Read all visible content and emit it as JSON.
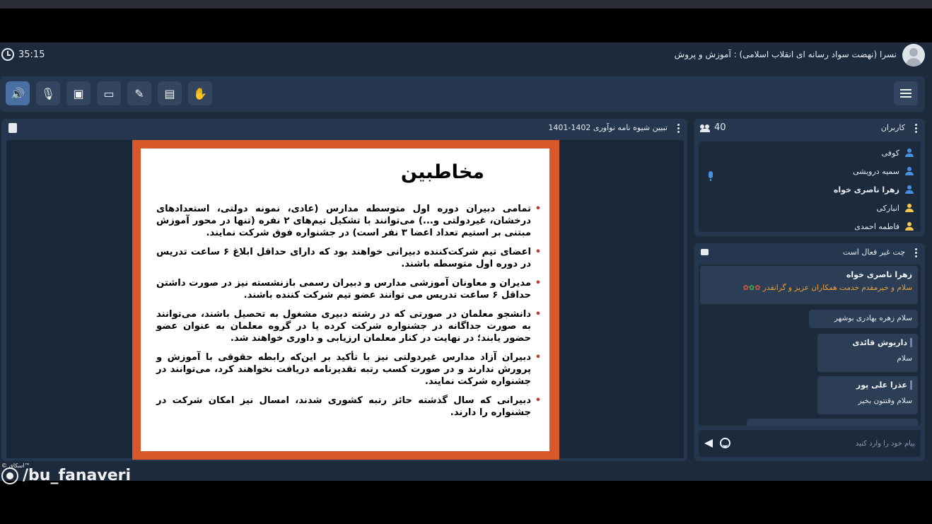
{
  "header": {
    "timer": "35:15",
    "meeting_title": "نسرا (نهضت سواد رسانه ای انقلاب اسلامی) : آموزش و پروش"
  },
  "toolbar": {
    "buttons": [
      {
        "icon": "speaker-icon",
        "glyph": "🔊"
      },
      {
        "icon": "mic-muted-icon",
        "glyph": "🎙"
      },
      {
        "icon": "camera-off-icon",
        "glyph": "▣"
      },
      {
        "icon": "screen-share-icon",
        "glyph": "▭"
      },
      {
        "icon": "brush-icon",
        "glyph": "✎"
      },
      {
        "icon": "briefcase-icon",
        "glyph": "▤"
      },
      {
        "icon": "hand-raise-icon",
        "glyph": "✋"
      }
    ]
  },
  "presentation": {
    "title": "تبیین شیوه نامه نوآوری 1402-1401",
    "slide_heading": "مخاطبین",
    "bullets": [
      "تمامی دبیران دوره اول متوسطه مدارس (عادی، نمونه دولتی، استعدادهای درخشان، غیردولتی و...) می‌توانند با تشکیل تیم‌های ۲ نفره (تنها در محور آموزش مبتنی بر استیم تعداد اعضا ۳ نفر است) در جشنواره فوق شرکت نمایند.",
      "اعضای تیم شرکت‌کننده دبیرانی خواهند بود که دارای حداقل ابلاغ ۶ ساعت تدریس در دوره اول متوسطه باشند.",
      "مدیران و معاونان آموزشی مدارس و دبیران رسمی بازنشسته نیز در صورت داشتن حداقل ۶ ساعت تدریس می توانند عضو تیم شرکت کننده باشند.",
      "دانشجو معلمان در صورتی که در رشته دبیری مشغول به تحصیل باشند، می‌توانند به صورت جداگانه در جشنواره شرکت کرده یا در گروه معلمان به عنوان عضو حضور یابند؛ در نهایت در کنار معلمان ارزیابی و داوری خواهند شد.",
      "دبیران آزاد مدارس غیردولتی نیز با تأکید بر این‌که رابطه حقوقی با آموزش و پرورش ندارند و در صورت کسب رتبه تقدیرنامه دریافت نخواهند کرد، می‌توانند در جشنواره شرکت نمایند.",
      "دبیرانی که سال گذشته حائز رتبه کشوری شدند، امسال نیز امکان شرکت در جشنواره را دارند."
    ]
  },
  "users": {
    "title": "کاربران",
    "count": "40",
    "list": [
      {
        "name": "کوفی",
        "color": "#4a90e2",
        "bold": false
      },
      {
        "name": "سمیه درویشی",
        "color": "#4a90e2",
        "bold": false
      },
      {
        "name": "زهرا ناصری خواه",
        "color": "#4a90e2",
        "bold": true
      },
      {
        "name": "انبارکی",
        "color": "#f2c94c",
        "bold": false
      },
      {
        "name": "فاطمه احمدی",
        "color": "#f2c94c",
        "bold": false
      }
    ]
  },
  "chat": {
    "title": "چت غیر فعال است",
    "messages": [
      {
        "sender": "زهرا ناصری خواه",
        "text": "سلام و خیرمقدم خدمت همکاران عزیز و گرانقدر"
      },
      {
        "sender": "",
        "text": "سلام زهره بهادری بوشهر"
      },
      {
        "sender": "داریوش قائدی",
        "text": "سلام"
      },
      {
        "sender": "عذرا علی پور",
        "text": "سلام وقتتون بخیر"
      }
    ],
    "input_placeholder": "پیام خود را وارد کنید"
  },
  "watermark": {
    "handle": "/bu_fanaveri",
    "small": "© اسکای™"
  }
}
